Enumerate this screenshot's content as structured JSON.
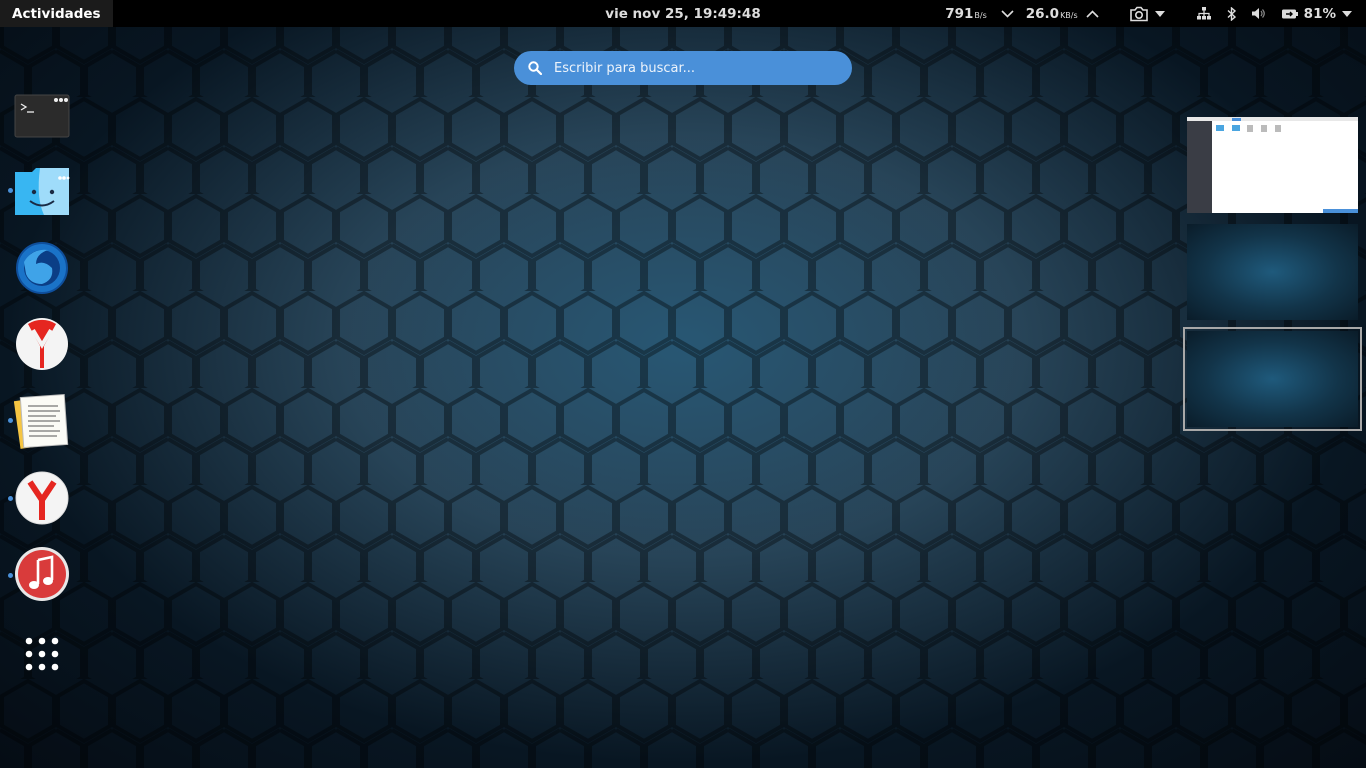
{
  "topbar": {
    "activities_label": "Actividades",
    "clock": "vie nov 25, 19:49:48",
    "net_down_value": "791",
    "net_down_unit": "B/s",
    "net_up_value": "26.0",
    "net_up_unit": "KB/s",
    "battery_percent": "81%",
    "icons": [
      "chevron-down-icon",
      "chevron-up-icon",
      "camera-icon",
      "network-icon",
      "bluetooth-icon",
      "volume-icon",
      "battery-icon",
      "system-menu-arrow-icon"
    ]
  },
  "search": {
    "placeholder": "Escribir para buscar..."
  },
  "dash": {
    "items": [
      {
        "name": "terminal",
        "running": false
      },
      {
        "name": "files-finder",
        "running": true
      },
      {
        "name": "firefox-developer",
        "running": false
      },
      {
        "name": "yandex-browser",
        "running": false
      },
      {
        "name": "text-editor-notes",
        "running": true
      },
      {
        "name": "yandex",
        "running": true
      },
      {
        "name": "music-player",
        "running": true
      },
      {
        "name": "show-applications",
        "running": false
      }
    ]
  },
  "workspaces": {
    "count": 3,
    "active_index": 2
  },
  "colors": {
    "accent": "#4a90d9",
    "topbar": "#000000"
  }
}
